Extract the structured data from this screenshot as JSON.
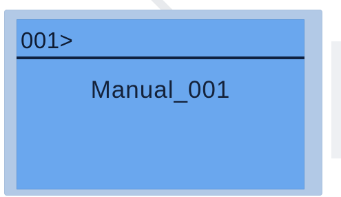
{
  "display": {
    "prompt": "001>",
    "program_name": "Manual_001"
  },
  "colors": {
    "frame": "#b2c9e6",
    "screen": "#6aa7ee",
    "text": "#0f1c33",
    "divider": "#0f2140"
  }
}
